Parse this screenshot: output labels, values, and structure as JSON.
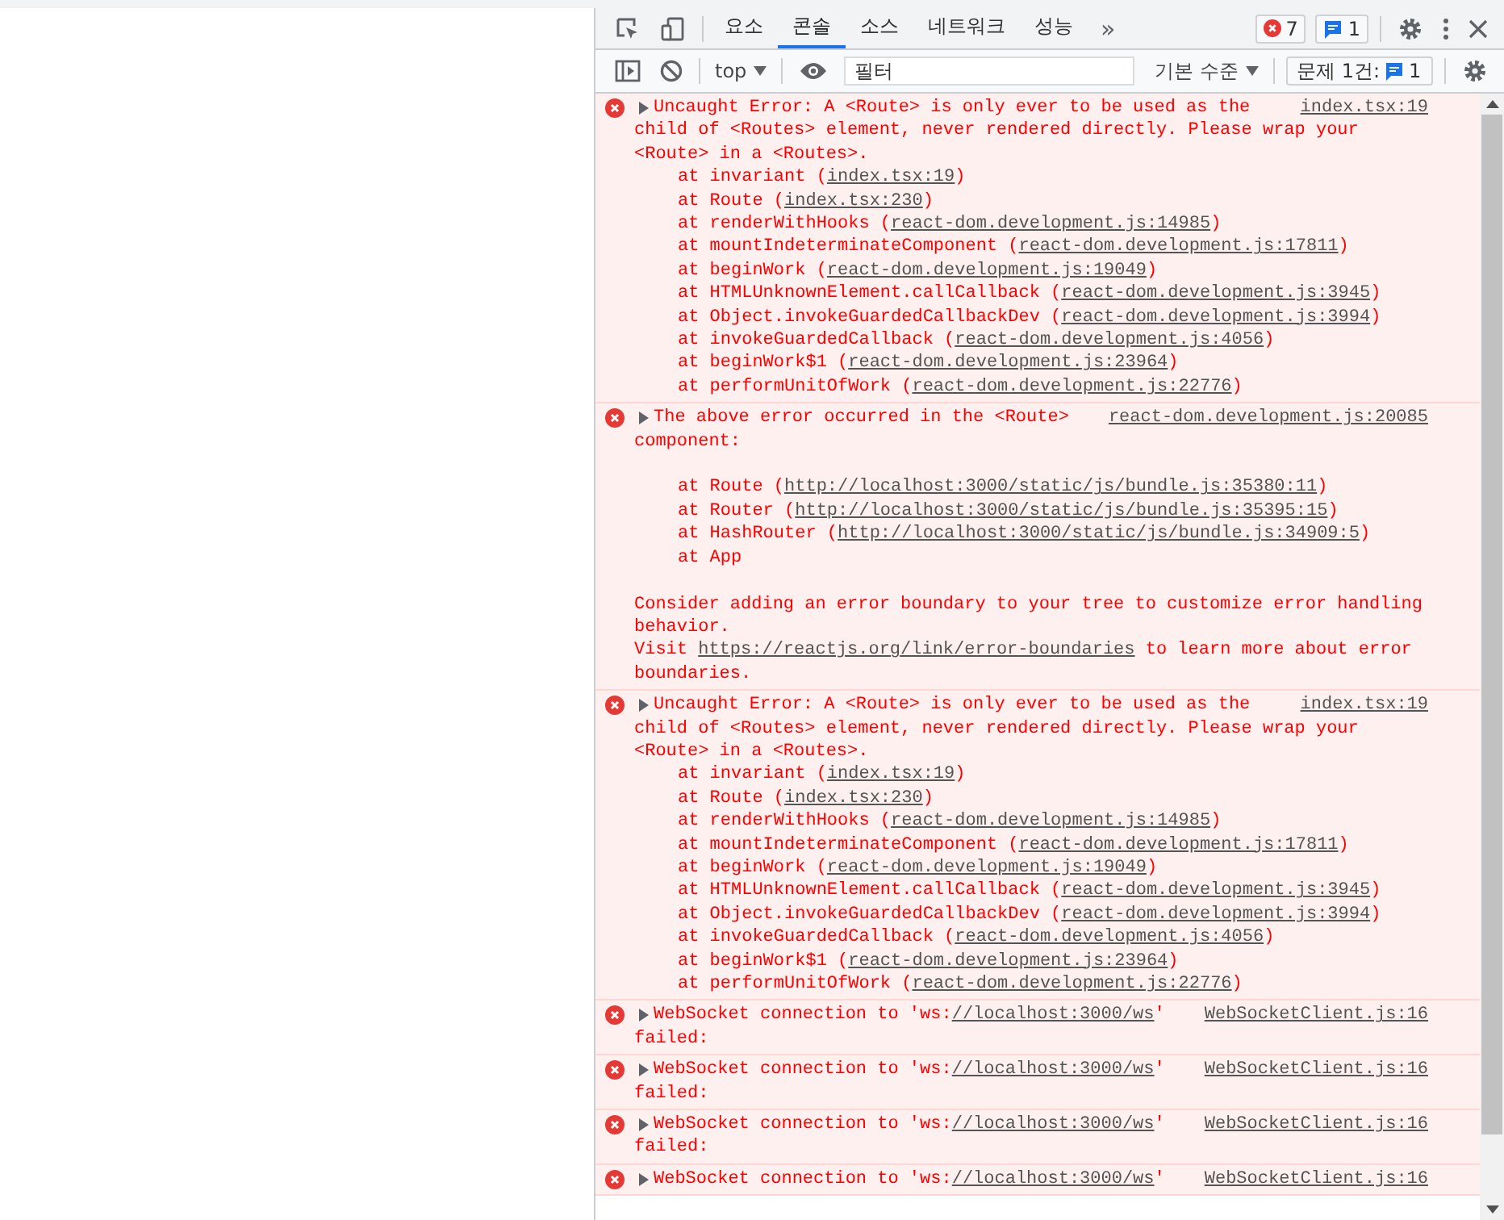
{
  "toolbar": {
    "tabs": [
      {
        "label": "요소",
        "selected": false
      },
      {
        "label": "콘솔",
        "selected": true
      },
      {
        "label": "소스",
        "selected": false
      },
      {
        "label": "네트워크",
        "selected": false
      },
      {
        "label": "성능",
        "selected": false
      }
    ],
    "more": "»",
    "error_count": "7",
    "message_count": "1"
  },
  "console_bar": {
    "context": "top",
    "filter": {
      "placeholder": "필터"
    },
    "level": "기본 수준",
    "issues": {
      "label": "문제 1건:",
      "count": "1"
    }
  },
  "messages": [
    {
      "source": "index.tsx:19",
      "lines": [
        {
          "kind": "text",
          "parts": [
            {
              "kind": "plain",
              "t": "Uncaught Error: A <Route> is only ever to be used as the"
            }
          ]
        },
        {
          "kind": "text",
          "parts": [
            {
              "kind": "plain",
              "t": "child of <Routes> element, never rendered directly. Please wrap your"
            }
          ]
        },
        {
          "kind": "text",
          "parts": [
            {
              "kind": "plain",
              "t": "<Route> in a <Routes>."
            }
          ]
        },
        {
          "kind": "frame",
          "parts": [
            {
              "kind": "plain",
              "t": "at invariant ("
            },
            {
              "kind": "link",
              "t": "index.tsx:19"
            },
            {
              "kind": "plain",
              "t": ")"
            }
          ]
        },
        {
          "kind": "frame",
          "parts": [
            {
              "kind": "plain",
              "t": "at Route ("
            },
            {
              "kind": "link",
              "t": "index.tsx:230"
            },
            {
              "kind": "plain",
              "t": ")"
            }
          ]
        },
        {
          "kind": "frame",
          "parts": [
            {
              "kind": "plain",
              "t": "at renderWithHooks ("
            },
            {
              "kind": "link",
              "t": "react-dom.development.js:14985"
            },
            {
              "kind": "plain",
              "t": ")"
            }
          ]
        },
        {
          "kind": "frame",
          "parts": [
            {
              "kind": "plain",
              "t": "at mountIndeterminateComponent ("
            },
            {
              "kind": "link",
              "t": "react-dom.development.js:17811"
            },
            {
              "kind": "plain",
              "t": ")"
            }
          ]
        },
        {
          "kind": "frame",
          "parts": [
            {
              "kind": "plain",
              "t": "at beginWork ("
            },
            {
              "kind": "link",
              "t": "react-dom.development.js:19049"
            },
            {
              "kind": "plain",
              "t": ")"
            }
          ]
        },
        {
          "kind": "frame",
          "parts": [
            {
              "kind": "plain",
              "t": "at HTMLUnknownElement.callCallback ("
            },
            {
              "kind": "link",
              "t": "react-dom.development.js:3945"
            },
            {
              "kind": "plain",
              "t": ")"
            }
          ]
        },
        {
          "kind": "frame",
          "parts": [
            {
              "kind": "plain",
              "t": "at Object.invokeGuardedCallbackDev ("
            },
            {
              "kind": "link",
              "t": "react-dom.development.js:3994"
            },
            {
              "kind": "plain",
              "t": ")"
            }
          ]
        },
        {
          "kind": "frame",
          "parts": [
            {
              "kind": "plain",
              "t": "at invokeGuardedCallback ("
            },
            {
              "kind": "link",
              "t": "react-dom.development.js:4056"
            },
            {
              "kind": "plain",
              "t": ")"
            }
          ]
        },
        {
          "kind": "frame",
          "parts": [
            {
              "kind": "plain",
              "t": "at beginWork$1 ("
            },
            {
              "kind": "link",
              "t": "react-dom.development.js:23964"
            },
            {
              "kind": "plain",
              "t": ")"
            }
          ]
        },
        {
          "kind": "frame",
          "parts": [
            {
              "kind": "plain",
              "t": "at performUnitOfWork ("
            },
            {
              "kind": "link",
              "t": "react-dom.development.js:22776"
            },
            {
              "kind": "plain",
              "t": ")"
            }
          ]
        }
      ]
    },
    {
      "source": "react-dom.development.js:20085",
      "lines": [
        {
          "kind": "text",
          "parts": [
            {
              "kind": "plain",
              "t": "The above error occurred in the <Route>"
            }
          ]
        },
        {
          "kind": "text",
          "parts": [
            {
              "kind": "plain",
              "t": "component:"
            }
          ]
        },
        {
          "kind": "blank"
        },
        {
          "kind": "frame",
          "parts": [
            {
              "kind": "plain",
              "t": "at Route ("
            },
            {
              "kind": "link",
              "t": "http://localhost:3000/static/js/bundle.js:35380:11"
            },
            {
              "kind": "plain",
              "t": ")"
            }
          ]
        },
        {
          "kind": "frame",
          "parts": [
            {
              "kind": "plain",
              "t": "at Router ("
            },
            {
              "kind": "link",
              "t": "http://localhost:3000/static/js/bundle.js:35395:15"
            },
            {
              "kind": "plain",
              "t": ")"
            }
          ]
        },
        {
          "kind": "frame",
          "parts": [
            {
              "kind": "plain",
              "t": "at HashRouter ("
            },
            {
              "kind": "link",
              "t": "http://localhost:3000/static/js/bundle.js:34909:5"
            },
            {
              "kind": "plain",
              "t": ")"
            }
          ]
        },
        {
          "kind": "frame",
          "parts": [
            {
              "kind": "plain",
              "t": "at App"
            }
          ]
        },
        {
          "kind": "blank"
        },
        {
          "kind": "text",
          "parts": [
            {
              "kind": "plain",
              "t": "Consider adding an error boundary to your tree to customize error handling"
            }
          ]
        },
        {
          "kind": "text",
          "parts": [
            {
              "kind": "plain",
              "t": "behavior."
            }
          ]
        },
        {
          "kind": "text",
          "parts": [
            {
              "kind": "plain",
              "t": "Visit "
            },
            {
              "kind": "link",
              "t": "https://reactjs.org/link/error-boundaries"
            },
            {
              "kind": "plain",
              "t": " to learn more about error"
            }
          ]
        },
        {
          "kind": "text",
          "parts": [
            {
              "kind": "plain",
              "t": "boundaries."
            }
          ]
        }
      ]
    },
    {
      "source": "index.tsx:19",
      "lines": [
        {
          "kind": "text",
          "parts": [
            {
              "kind": "plain",
              "t": "Uncaught Error: A <Route> is only ever to be used as the"
            }
          ]
        },
        {
          "kind": "text",
          "parts": [
            {
              "kind": "plain",
              "t": "child of <Routes> element, never rendered directly. Please wrap your"
            }
          ]
        },
        {
          "kind": "text",
          "parts": [
            {
              "kind": "plain",
              "t": "<Route> in a <Routes>."
            }
          ]
        },
        {
          "kind": "frame",
          "parts": [
            {
              "kind": "plain",
              "t": "at invariant ("
            },
            {
              "kind": "link",
              "t": "index.tsx:19"
            },
            {
              "kind": "plain",
              "t": ")"
            }
          ]
        },
        {
          "kind": "frame",
          "parts": [
            {
              "kind": "plain",
              "t": "at Route ("
            },
            {
              "kind": "link",
              "t": "index.tsx:230"
            },
            {
              "kind": "plain",
              "t": ")"
            }
          ]
        },
        {
          "kind": "frame",
          "parts": [
            {
              "kind": "plain",
              "t": "at renderWithHooks ("
            },
            {
              "kind": "link",
              "t": "react-dom.development.js:14985"
            },
            {
              "kind": "plain",
              "t": ")"
            }
          ]
        },
        {
          "kind": "frame",
          "parts": [
            {
              "kind": "plain",
              "t": "at mountIndeterminateComponent ("
            },
            {
              "kind": "link",
              "t": "react-dom.development.js:17811"
            },
            {
              "kind": "plain",
              "t": ")"
            }
          ]
        },
        {
          "kind": "frame",
          "parts": [
            {
              "kind": "plain",
              "t": "at beginWork ("
            },
            {
              "kind": "link",
              "t": "react-dom.development.js:19049"
            },
            {
              "kind": "plain",
              "t": ")"
            }
          ]
        },
        {
          "kind": "frame",
          "parts": [
            {
              "kind": "plain",
              "t": "at HTMLUnknownElement.callCallback ("
            },
            {
              "kind": "link",
              "t": "react-dom.development.js:3945"
            },
            {
              "kind": "plain",
              "t": ")"
            }
          ]
        },
        {
          "kind": "frame",
          "parts": [
            {
              "kind": "plain",
              "t": "at Object.invokeGuardedCallbackDev ("
            },
            {
              "kind": "link",
              "t": "react-dom.development.js:3994"
            },
            {
              "kind": "plain",
              "t": ")"
            }
          ]
        },
        {
          "kind": "frame",
          "parts": [
            {
              "kind": "plain",
              "t": "at invokeGuardedCallback ("
            },
            {
              "kind": "link",
              "t": "react-dom.development.js:4056"
            },
            {
              "kind": "plain",
              "t": ")"
            }
          ]
        },
        {
          "kind": "frame",
          "parts": [
            {
              "kind": "plain",
              "t": "at beginWork$1 ("
            },
            {
              "kind": "link",
              "t": "react-dom.development.js:23964"
            },
            {
              "kind": "plain",
              "t": ")"
            }
          ]
        },
        {
          "kind": "frame",
          "parts": [
            {
              "kind": "plain",
              "t": "at performUnitOfWork ("
            },
            {
              "kind": "link",
              "t": "react-dom.development.js:22776"
            },
            {
              "kind": "plain",
              "t": ")"
            }
          ]
        }
      ]
    },
    {
      "source": "WebSocketClient.js:16",
      "lines": [
        {
          "kind": "text",
          "parts": [
            {
              "kind": "plain",
              "t": "WebSocket connection to 'ws:"
            },
            {
              "kind": "link",
              "t": "//localhost:3000/ws"
            },
            {
              "kind": "plain",
              "t": "'"
            }
          ]
        },
        {
          "kind": "text",
          "parts": [
            {
              "kind": "plain",
              "t": "failed:"
            }
          ]
        }
      ]
    },
    {
      "source": "WebSocketClient.js:16",
      "lines": [
        {
          "kind": "text",
          "parts": [
            {
              "kind": "plain",
              "t": "WebSocket connection to 'ws:"
            },
            {
              "kind": "link",
              "t": "//localhost:3000/ws"
            },
            {
              "kind": "plain",
              "t": "'"
            }
          ]
        },
        {
          "kind": "text",
          "parts": [
            {
              "kind": "plain",
              "t": "failed:"
            }
          ]
        }
      ]
    },
    {
      "source": "WebSocketClient.js:16",
      "lines": [
        {
          "kind": "text",
          "parts": [
            {
              "kind": "plain",
              "t": "WebSocket connection to 'ws:"
            },
            {
              "kind": "link",
              "t": "//localhost:3000/ws"
            },
            {
              "kind": "plain",
              "t": "'"
            }
          ]
        },
        {
          "kind": "text",
          "parts": [
            {
              "kind": "plain",
              "t": "failed:"
            }
          ]
        }
      ]
    },
    {
      "source": "WebSocketClient.js:16",
      "lines": [
        {
          "kind": "text",
          "parts": [
            {
              "kind": "plain",
              "t": "WebSocket connection to 'ws:"
            },
            {
              "kind": "link",
              "t": "//localhost:3000/ws"
            },
            {
              "kind": "plain",
              "t": "'"
            }
          ]
        }
      ]
    }
  ]
}
